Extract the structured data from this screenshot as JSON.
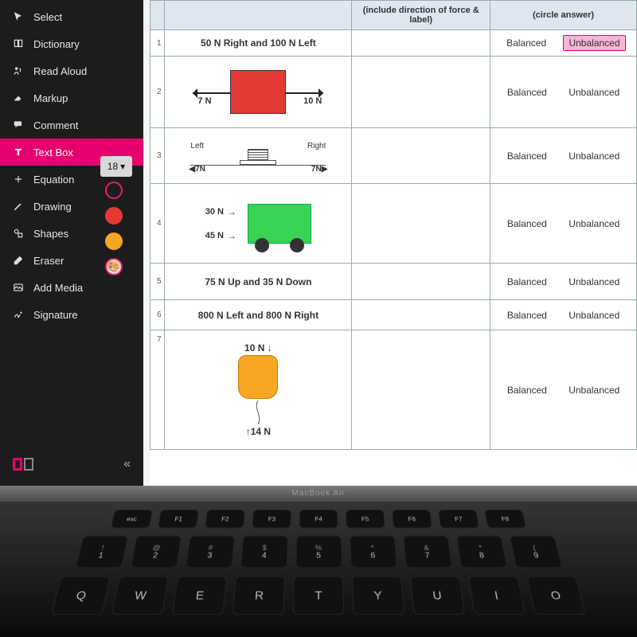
{
  "sidebar": {
    "tools": [
      {
        "label": "Select",
        "icon": "cursor"
      },
      {
        "label": "Dictionary",
        "icon": "book"
      },
      {
        "label": "Read Aloud",
        "icon": "speak"
      },
      {
        "label": "Markup",
        "icon": "highlight"
      },
      {
        "label": "Comment",
        "icon": "comment"
      },
      {
        "label": "Text Box",
        "icon": "text",
        "active": true
      },
      {
        "label": "Equation",
        "icon": "equation"
      },
      {
        "label": "Drawing",
        "icon": "pencil"
      },
      {
        "label": "Shapes",
        "icon": "shapes"
      },
      {
        "label": "Eraser",
        "icon": "eraser"
      },
      {
        "label": "Add Media",
        "icon": "media"
      },
      {
        "label": "Signature",
        "icon": "signature"
      }
    ],
    "font_size": "18",
    "swatches": [
      "outline",
      "red",
      "orange"
    ],
    "collapse_glyph": "«"
  },
  "table": {
    "header_mid": "(include direction of force & label)",
    "header_ans": "(circle answer)",
    "rows": [
      {
        "n": "1",
        "desc": "50 N Right and 100 N Left",
        "balanced": "Balanced",
        "unbalanced": "Unbalanced",
        "selected": "unbalanced",
        "kind": "text"
      },
      {
        "n": "2",
        "left": "7 N",
        "right": "10 N",
        "balanced": "Balanced",
        "unbalanced": "Unbalanced",
        "kind": "redbox"
      },
      {
        "n": "3",
        "leftlabel": "Left",
        "rightlabel": "Right",
        "leftval": "7N",
        "rightval": "7N",
        "balanced": "Balanced",
        "unbalanced": "Unbalanced",
        "kind": "platform"
      },
      {
        "n": "4",
        "top": "30 N",
        "bottom": "45 N",
        "balanced": "Balanced",
        "unbalanced": "Unbalanced",
        "kind": "cart"
      },
      {
        "n": "5",
        "desc": "75 N Up and 35 N Down",
        "balanced": "Balanced",
        "unbalanced": "Unbalanced",
        "kind": "text"
      },
      {
        "n": "6",
        "desc": "800 N Left and 800 N Right",
        "balanced": "Balanced",
        "unbalanced": "Unbalanced",
        "kind": "text"
      },
      {
        "n": "7",
        "top": "10 N",
        "bottom": "14 N",
        "balanced": "Balanced",
        "unbalanced": "Unbalanced",
        "kind": "balloon"
      }
    ]
  },
  "laptop": {
    "brand": "MacBook Air",
    "fn_row": [
      "esc",
      "F1",
      "F2",
      "F3",
      "F4",
      "F5",
      "F6",
      "F7",
      "F8"
    ],
    "num_row": [
      [
        "!",
        "1"
      ],
      [
        "@",
        "2"
      ],
      [
        "#",
        "3"
      ],
      [
        "$",
        "4"
      ],
      [
        "%",
        "5"
      ],
      [
        "^",
        "6"
      ],
      [
        "&",
        "7"
      ],
      [
        "*",
        "8"
      ],
      [
        "(",
        "9"
      ]
    ],
    "letter_row": [
      "Q",
      "W",
      "E",
      "R",
      "T",
      "Y",
      "U",
      "I",
      "O"
    ]
  }
}
